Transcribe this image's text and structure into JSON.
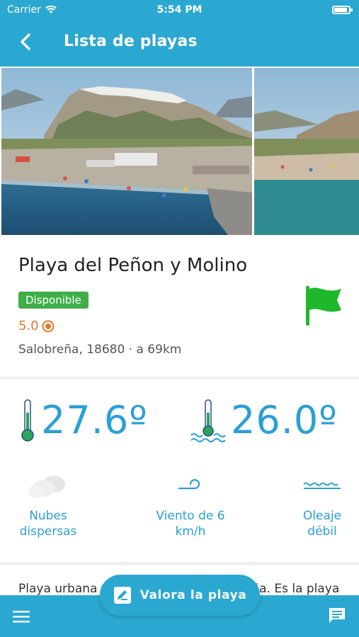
{
  "status_bar": {
    "carrier": "Carrier",
    "time": "5:54 PM"
  },
  "nav": {
    "title": "Lista de playas"
  },
  "beach": {
    "name": "Playa del Peñon y Molino",
    "status": "Disponible",
    "rating": "5.0",
    "location": "Salobreña, 18680 · a 69km",
    "flag_color": "#1fb82d"
  },
  "weather": {
    "air_temp": "27.6º",
    "water_temp": "26.0º",
    "conditions": [
      {
        "icon": "clouds-icon",
        "label": "Nubes dispersas"
      },
      {
        "icon": "wind-icon",
        "label": "Viento de 6 km/h"
      },
      {
        "icon": "waves-icon",
        "label": "Oleaje débil"
      }
    ]
  },
  "description": "Playa urbana y semiurbana de Salobreña. Es la playa",
  "actions": {
    "rate_label": "Valora la playa"
  },
  "colors": {
    "primary": "#2aa8d1",
    "accent": "#2a9fd6",
    "badge": "#3fae49",
    "rating": "#e07a2b"
  }
}
